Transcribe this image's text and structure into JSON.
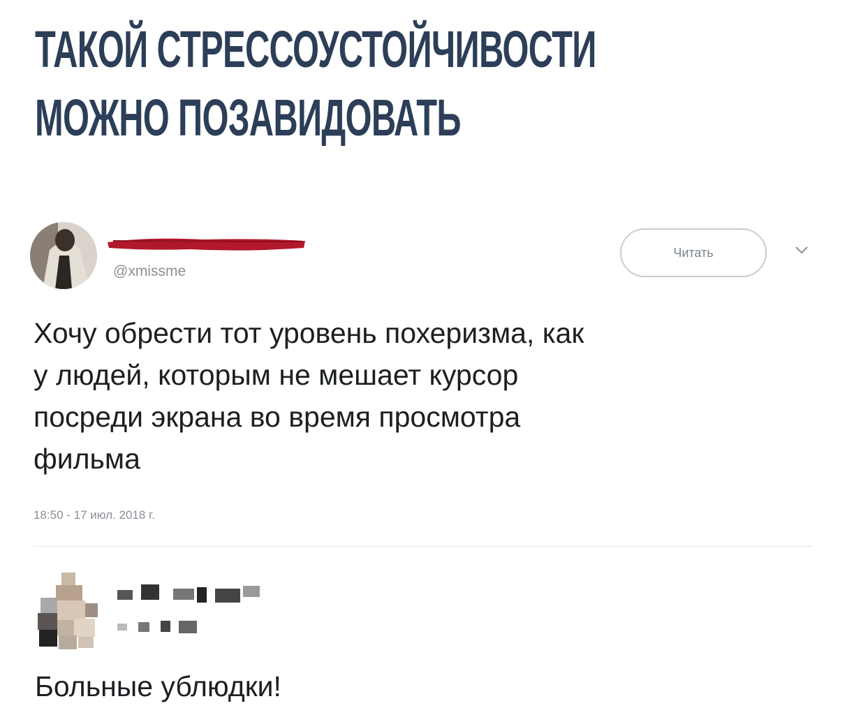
{
  "headline": {
    "line1": "ТАКОЙ СТРЕССОУСТОЙЧИВОСТИ",
    "line2": "МОЖНО ПОЗАВИДОВАТЬ"
  },
  "tweet": {
    "handle": "@xmissme",
    "follow_label": "Читать",
    "text_lines": [
      "Хочу обрести тот уровень похеризма, как",
      "у людей, которым не мешает курсор",
      "посреди экрана во время просмотра",
      "фильма"
    ],
    "timestamp": "18:50 - 17 июл. 2018 г."
  },
  "reply": {
    "text": "Больные ублюдки!"
  },
  "colors": {
    "headline": "#2c3e58",
    "redaction": "#b2182b",
    "text": "#1c1f22",
    "muted": "#8a8f95"
  },
  "icons": {
    "menu": "chevron-down-icon"
  }
}
